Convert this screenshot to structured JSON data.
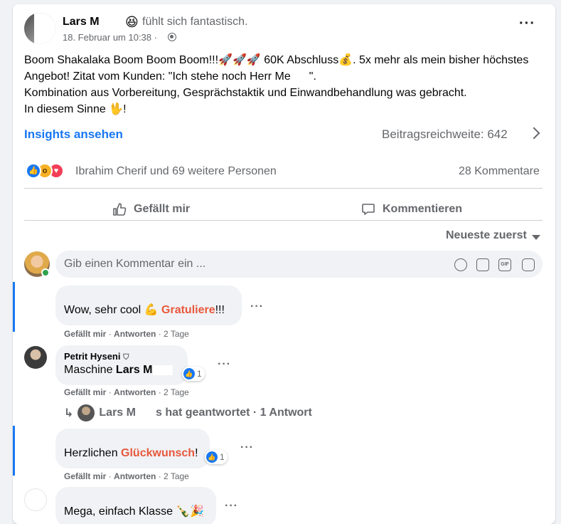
{
  "post": {
    "author": "Lars M",
    "feeling": "fühlt sich fantastisch.",
    "feeling_icon": "😆",
    "date": "18. Februar um 10:38 ·",
    "text_lines": [
      "Boom Shakalaka Boom Boom Boom!!!🚀🚀🚀 60K Abschluss💰. 5x mehr als mein bisher höchstes",
      "Kombination aus Vorbereitung, Gesprächstaktik und Einwandbehandlung was gebracht.",
      "In diesem Sinne 🖖!"
    ],
    "line2_prefix": "Angebot! Zitat vom Kunden: \"Ich stehe noch Herr Me",
    "line2_suffix": "\".",
    "insights_label": "Insights ansehen",
    "reach_label": "Beitragsreichweite: 642",
    "reactors_text": "Ibrahim Cherif und 69 weitere Personen",
    "comment_count": "28 Kommentare",
    "like_action": "Gefällt mir",
    "comment_action": "Kommentieren"
  },
  "comments_section": {
    "sort_label": "Neueste zuerst",
    "input_placeholder": "Gib einen Kommentar ein ..."
  },
  "comments": [
    {
      "name": "",
      "text_prefix": "Wow, sehr cool 💪 ",
      "highlight": "Gratuliere",
      "text_suffix": "!!!",
      "meta_like": "Gefällt mir",
      "meta_reply": "Antworten",
      "meta_time": "2 Tage"
    },
    {
      "name": "Petrit Hyseni",
      "text_prefix": "Maschine ",
      "mention": "Lars M",
      "like_count": "1",
      "meta_like": "Gefällt mir",
      "meta_reply": "Antworten",
      "meta_time": "2 Tage",
      "reply_summary_name": "Lars M",
      "reply_summary_text": "s hat geantwortet · 1 Antwort"
    },
    {
      "name": "",
      "text_prefix": "Herzlichen ",
      "highlight": "Glückwunsch",
      "text_suffix": "!",
      "like_count": "1",
      "meta_like": "Gefällt mir",
      "meta_reply": "Antworten",
      "meta_time": "2 Tage"
    },
    {
      "name": "",
      "text_prefix": "Mega, einfach Klasse 🍾🎉"
    }
  ],
  "colors": {
    "accent": "#1877f2",
    "highlight": "#e8583c",
    "secondary_text": "#65676b"
  }
}
